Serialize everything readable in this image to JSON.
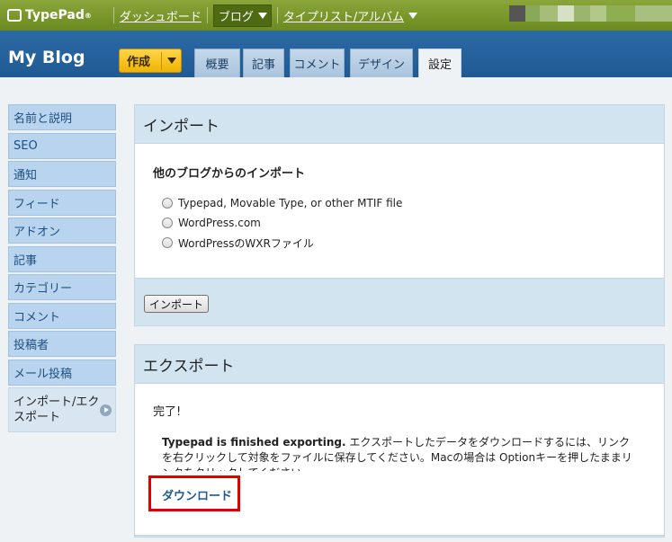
{
  "topbar": {
    "logo": "TypePad",
    "logo_mark": "®",
    "dashboard": "ダッシュボード",
    "blogs": "ブログ",
    "typelists": "タイプリスト/アルバム"
  },
  "header": {
    "blog_title": "My Blog",
    "create": "作成",
    "tabs": [
      "概要",
      "記事",
      "コメント",
      "デザイン",
      "設定"
    ]
  },
  "sidebar": {
    "items": [
      "名前と説明",
      "SEO",
      "通知",
      "フィード",
      "アドオン",
      "記事",
      "カテゴリー",
      "コメント",
      "投稿者",
      "メール投稿"
    ],
    "active": "インポート/エクスポート"
  },
  "import": {
    "title": "インポート",
    "subtitle": "他のブログからのインポート",
    "options": [
      "Typepad, Movable Type, or other MTIF file",
      "WordPress.com",
      "WordPressのWXRファイル"
    ],
    "button": "インポート"
  },
  "export": {
    "title": "エクスポート",
    "done": "完了!",
    "message_bold": "Typepad is finished exporting.",
    "message_rest": " エクスポートしたデータをダウンロードするには、リンクを右クリックして対象をファイルに保存してください。Macの場合は Optionキーを押したままリンクをクリックしてください。",
    "download": "ダウンロード"
  },
  "colors": {
    "topbar": "#7a971f",
    "header": "#2566a0",
    "sidebar_item": "#b9d4ee",
    "highlight": "#e00000"
  }
}
